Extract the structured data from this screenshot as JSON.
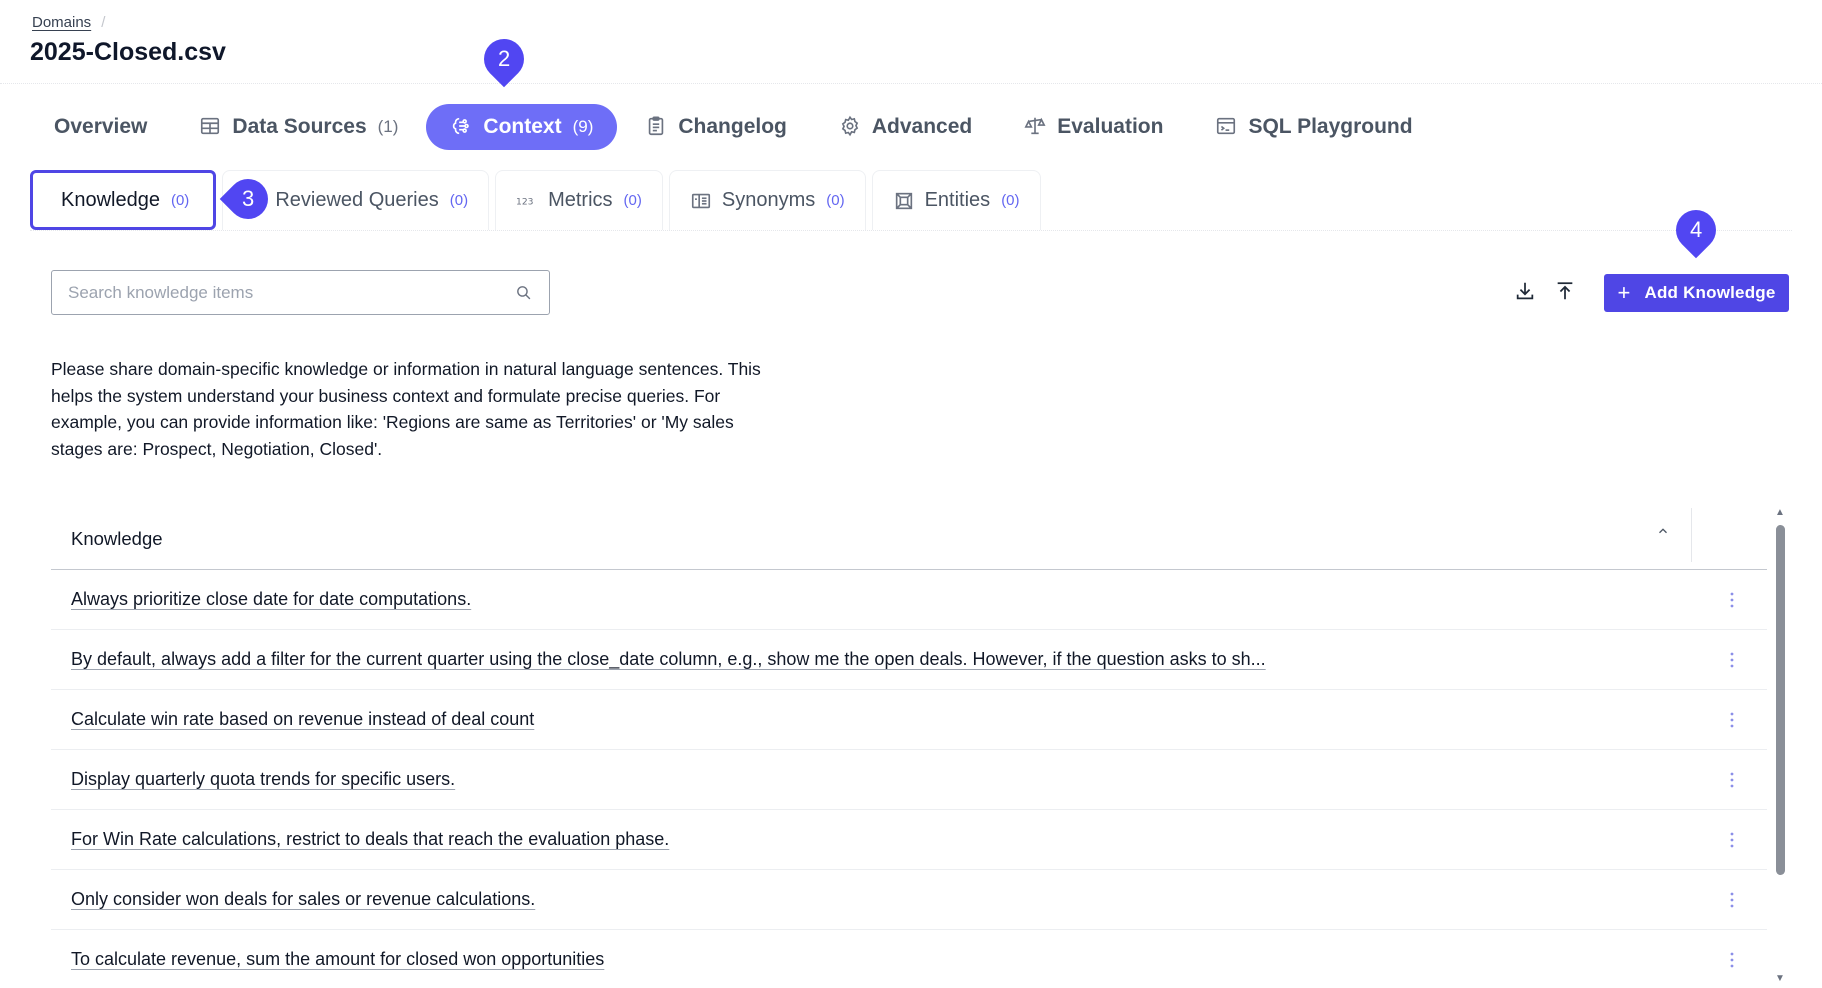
{
  "breadcrumb": {
    "items": [
      "Domains"
    ],
    "separator": "/"
  },
  "page_title": "2025-Closed.csv",
  "main_tabs": [
    {
      "label": "Overview",
      "count": "",
      "icon": "none",
      "active": false
    },
    {
      "label": "Data Sources",
      "count": "(1)",
      "icon": "table-icon",
      "active": false
    },
    {
      "label": "Context",
      "count": "(9)",
      "icon": "brain-icon",
      "active": true
    },
    {
      "label": "Changelog",
      "count": "",
      "icon": "clipboard-icon",
      "active": false
    },
    {
      "label": "Advanced",
      "count": "",
      "icon": "gear-icon",
      "active": false
    },
    {
      "label": "Evaluation",
      "count": "",
      "icon": "scale-icon",
      "active": false
    },
    {
      "label": "SQL Playground",
      "count": "",
      "icon": "terminal-window-icon",
      "active": false
    }
  ],
  "sub_tabs": [
    {
      "label": "Knowledge",
      "count": "(0)",
      "icon": "none",
      "active": true
    },
    {
      "label": "Reviewed Queries",
      "count": "(0)",
      "icon": "list-icon",
      "active": false
    },
    {
      "label": "Metrics",
      "count": "(0)",
      "icon": "number-123-icon",
      "active": false
    },
    {
      "label": "Synonyms",
      "count": "(0)",
      "icon": "dictionary-icon",
      "active": false
    },
    {
      "label": "Entities",
      "count": "(0)",
      "icon": "entity-frame-icon",
      "active": false
    }
  ],
  "markers": {
    "context": "2",
    "knowledge": "3",
    "add": "4"
  },
  "search": {
    "placeholder": "Search knowledge items",
    "value": ""
  },
  "toolbar": {
    "download_icon": "download-icon",
    "upload_icon": "upload-icon",
    "add_label": "Add Knowledge",
    "add_icon": "plus-icon"
  },
  "description": "Please share domain-specific knowledge or information in natural language sentences. This helps the system understand your business context and formulate precise queries. For example, you can provide information like: 'Regions are same as Territories' or 'My sales stages are: Prospect, Negotiation, Closed'.",
  "table": {
    "header": "Knowledge",
    "rows": [
      "Always prioritize close date for date computations.",
      "By default, always add a filter for the current quarter using the close_date column, e.g., show me the open deals. However, if the question asks to sh...",
      "Calculate win rate based on revenue instead of deal count",
      "Display quarterly quota trends for specific users.",
      "For Win Rate calculations, restrict to deals that reach the evaluation phase.",
      "Only consider won deals for sales or revenue calculations.",
      "To calculate revenue, sum the amount for closed won opportunities"
    ]
  },
  "colors": {
    "accent": "#4f46e5",
    "active_tab": "#6e6ef7",
    "marker": "#5146f2"
  }
}
